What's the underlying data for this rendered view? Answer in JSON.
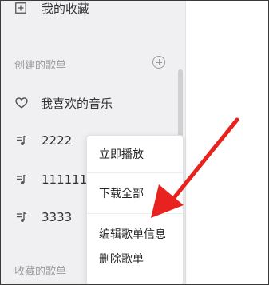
{
  "sidebar": {
    "collection_item": {
      "label": "我的收藏",
      "icon": "collection-icon"
    },
    "created_section": {
      "title": "创建的歌单",
      "add_icon": "add-circle-icon"
    },
    "favorite_item": {
      "label": "我喜欢的音乐",
      "icon": "heart-outline-icon"
    },
    "playlists": [
      {
        "label": "2222",
        "icon": "playlist-icon"
      },
      {
        "label": "1111111",
        "icon": "playlist-icon"
      },
      {
        "label": "3333",
        "icon": "playlist-icon"
      }
    ],
    "collected_section": {
      "title": "收藏的歌单"
    }
  },
  "context_menu": {
    "items": [
      {
        "label": "立即播放"
      },
      {
        "label": "下载全部"
      },
      {
        "label": "编辑歌单信息"
      },
      {
        "label": "删除歌单"
      }
    ]
  },
  "annotation": {
    "color": "#e8231f",
    "icon": "red-arrow"
  },
  "colors": {
    "sidebar_bg": "#f0f0f2",
    "main_bg": "#ffffff",
    "section_title": "#9a9a9a",
    "text": "#333333"
  }
}
